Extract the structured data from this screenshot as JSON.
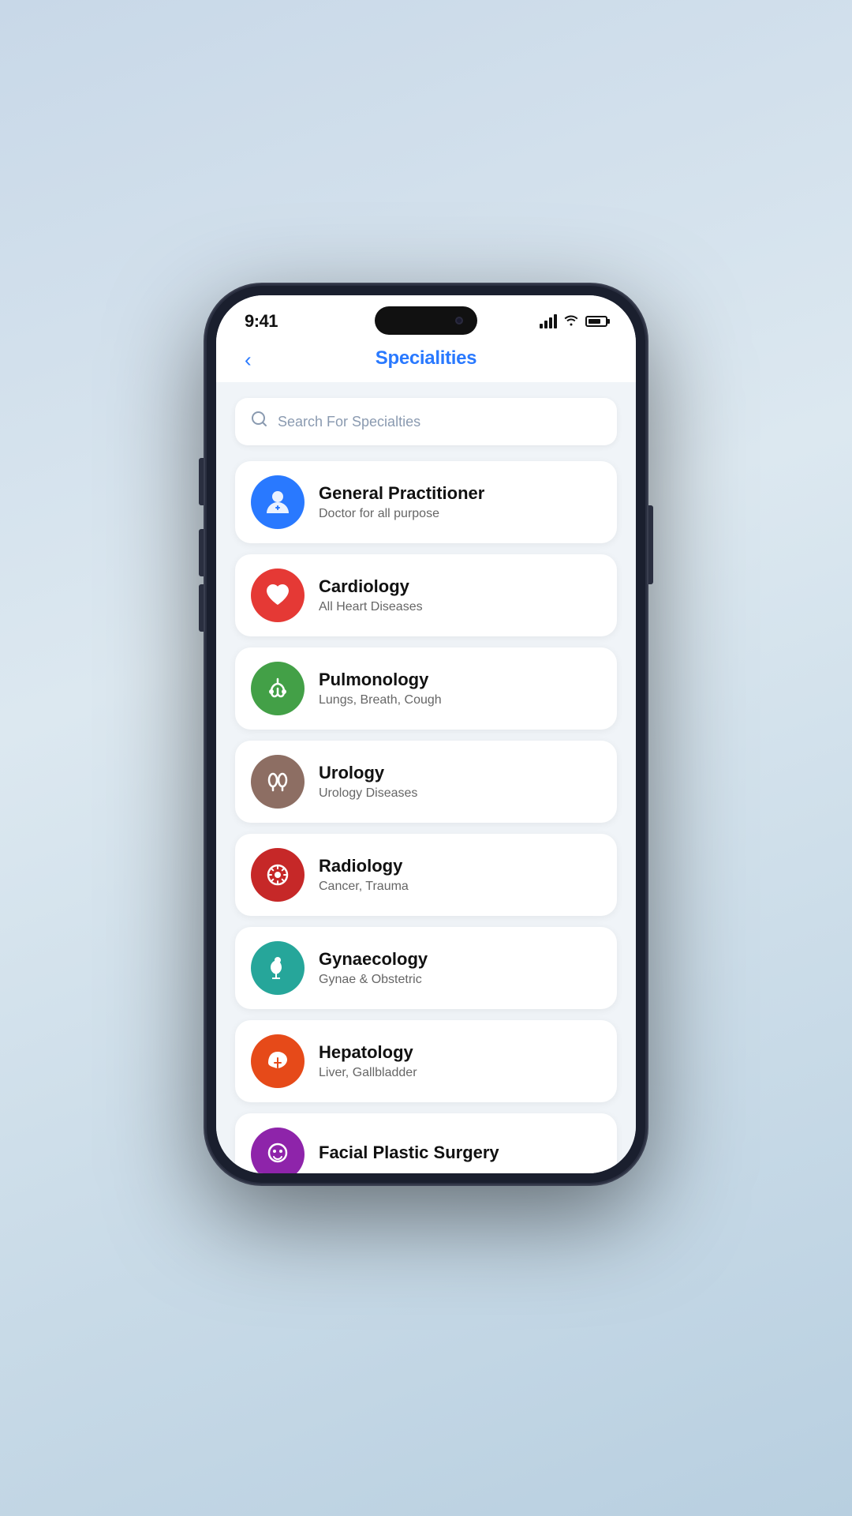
{
  "status": {
    "time": "9:41"
  },
  "header": {
    "back_label": "‹",
    "title": "Specialities"
  },
  "search": {
    "placeholder": "Search For Specialties"
  },
  "specialties": [
    {
      "id": "general-practitioner",
      "name": "General Practitioner",
      "desc": "Doctor for all purpose",
      "icon_color": "icon-blue",
      "icon": "gp"
    },
    {
      "id": "cardiology",
      "name": "Cardiology",
      "desc": "All Heart Diseases",
      "icon_color": "icon-red",
      "icon": "heart"
    },
    {
      "id": "pulmonology",
      "name": "Pulmonology",
      "desc": "Lungs, Breath, Cough",
      "icon_color": "icon-green",
      "icon": "lungs"
    },
    {
      "id": "urology",
      "name": "Urology",
      "desc": "Urology Diseases",
      "icon_color": "icon-brown",
      "icon": "urology"
    },
    {
      "id": "radiology",
      "name": "Radiology",
      "desc": "Cancer, Trauma",
      "icon_color": "icon-dark-red",
      "icon": "radiology"
    },
    {
      "id": "gynaecology",
      "name": "Gynaecology",
      "desc": "Gynae & Obstetric",
      "icon_color": "icon-teal",
      "icon": "gynae"
    },
    {
      "id": "hepatology",
      "name": "Hepatology",
      "desc": "Liver, Gallbladder",
      "icon_color": "icon-orange",
      "icon": "liver"
    },
    {
      "id": "facial-plastic-surgery",
      "name": "Facial Plastic Surgery",
      "desc": "",
      "icon_color": "icon-purple",
      "icon": "face"
    }
  ]
}
